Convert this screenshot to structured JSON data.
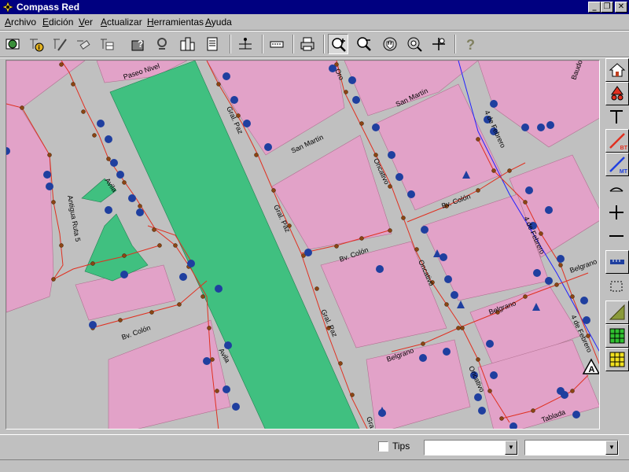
{
  "window": {
    "title": "Compass Red"
  },
  "menu": [
    {
      "label": "Archivo",
      "mnemonic": "A",
      "rest": "rchivo"
    },
    {
      "label": "Edición",
      "mnemonic": "E",
      "rest": "dición"
    },
    {
      "label": "Ver",
      "mnemonic": "V",
      "rest": "er"
    },
    {
      "label": "Actualizar",
      "mnemonic": "A",
      "rest": "ctualizar"
    },
    {
      "label": "Herramientas",
      "mnemonic": "H",
      "rest": "erramientas"
    },
    {
      "label": "Ayuda",
      "mnemonic": "A",
      "rest": "yuda"
    }
  ],
  "toolbar": {
    "buttons": [
      "globe-icon",
      "info-node-icon",
      "edit-line-icon",
      "eraser-icon",
      "table-edit-icon",
      "query-icon",
      "stamp-icon",
      "buildings-icon",
      "report-icon",
      "scale-icon",
      "tag-icon",
      "print-icon",
      "zoom-in-icon",
      "zoom-out-icon",
      "pan-hand-icon",
      "zoom-extent-icon",
      "move-icon",
      "help-icon"
    ],
    "pressed": "zoom-in-icon"
  },
  "map": {
    "colors": {
      "block": "#e2a2c8",
      "street": "#c0c0c0",
      "park": "#40c080",
      "line": "#e03020",
      "pole": "#8b4513",
      "client": "#1f3f9f",
      "blue_line": "#2020ff"
    },
    "streets": [
      "Paseo Nivel",
      "Gral. Paz",
      "Gral. Paz",
      "Gral. Paz",
      "San Martín",
      "San Martín",
      "Oncativo",
      "Oncativo",
      "Oncativo",
      "4 de Febrero",
      "4 de Febrero",
      "4 de Febrero",
      "Bv. Colón",
      "Bv. Colón",
      "Bv. Colón",
      "Belgrano",
      "Belgrano",
      "Belgrano",
      "Tablada",
      "Antigua Ruta 5",
      "Avila",
      "Avila",
      "Baudo",
      "Oro",
      "Gra"
    ]
  },
  "right_tools": [
    {
      "name": "home-icon",
      "label": ""
    },
    {
      "name": "transformer-icon",
      "label": ""
    },
    {
      "name": "t-pole-icon",
      "label": ""
    },
    {
      "name": "bt-line-icon",
      "label": "BT"
    },
    {
      "name": "mt-line-icon",
      "label": "MT"
    },
    {
      "name": "arc-icon",
      "label": ""
    },
    {
      "name": "cross-icon",
      "label": ""
    },
    {
      "name": "dash-icon",
      "label": ""
    },
    {
      "name": "ruler-icon",
      "label": ""
    },
    {
      "name": "select-rect-icon",
      "label": ""
    },
    {
      "name": "hatch-icon",
      "label": ""
    },
    {
      "name": "grid-green-icon",
      "label": ""
    },
    {
      "name": "grid-yellow-icon",
      "label": ""
    }
  ],
  "status": {
    "tips_label": "Tips",
    "combo1_value": "",
    "combo2_value": ""
  }
}
